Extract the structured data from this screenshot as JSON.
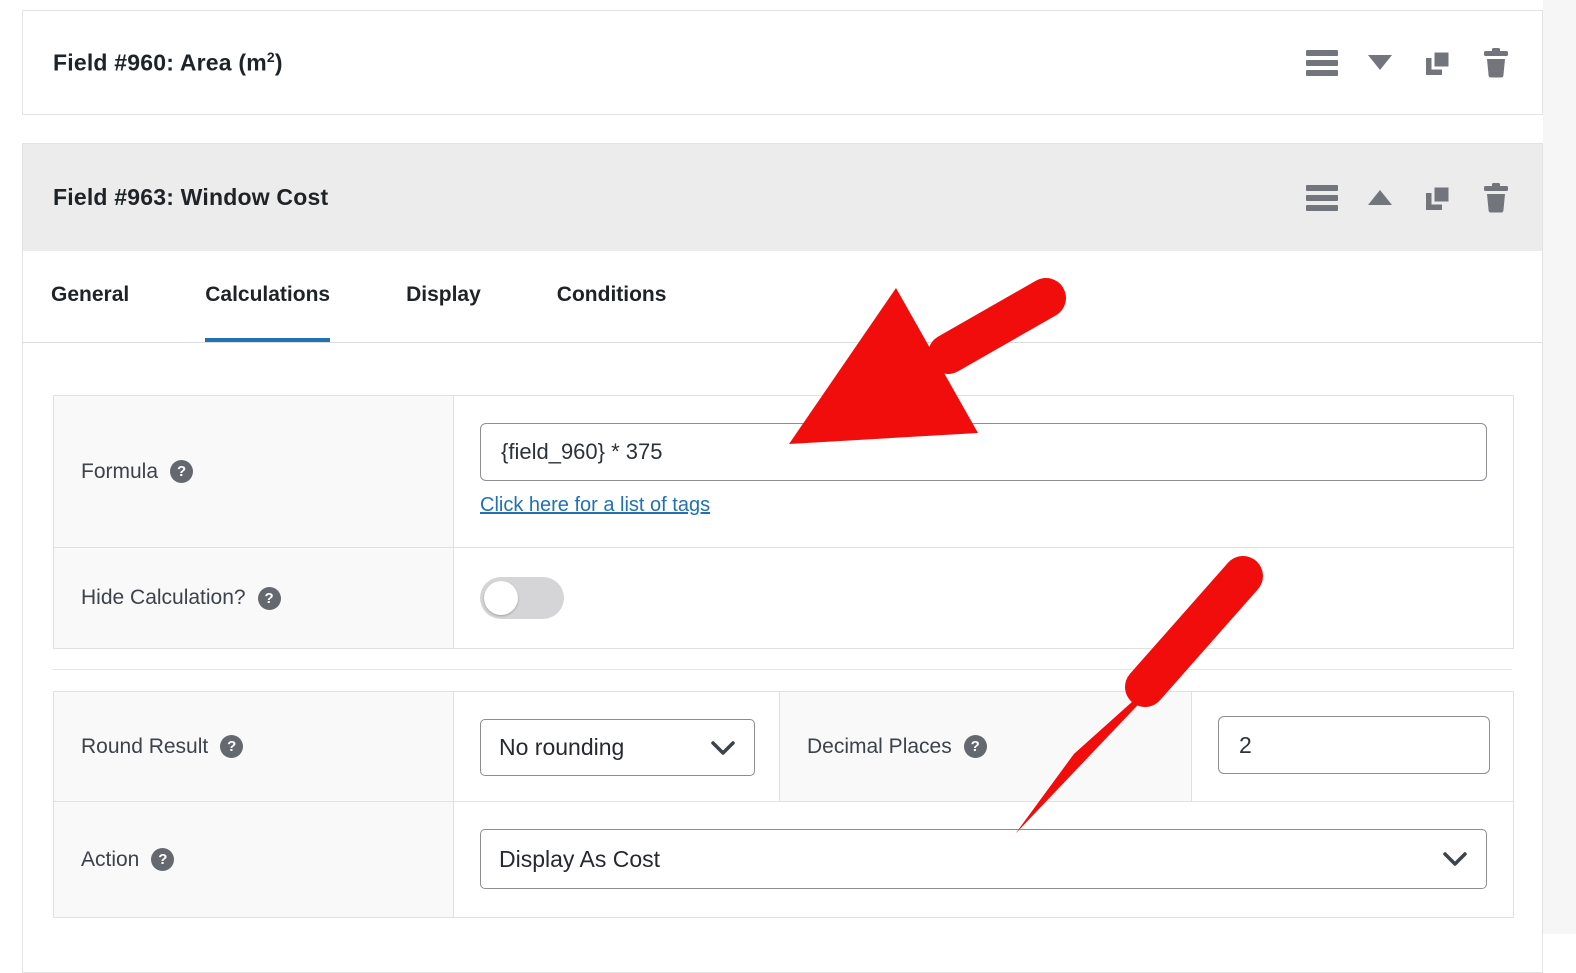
{
  "colors": {
    "accent_blue": "#2271b1",
    "annotation_red": "#f20d0d",
    "header_gray": "#ececec",
    "label_cell_bg": "#f9f9f9",
    "icon_gray": "#72767c"
  },
  "icons": {
    "help_glyph": "?"
  },
  "field_960": {
    "title_prefix": "Field #960: Area (m",
    "title_sup": "2",
    "title_suffix": ")"
  },
  "field_963": {
    "title": "Field #963: Window Cost",
    "tabs": [
      {
        "label": "General",
        "active": false
      },
      {
        "label": "Calculations",
        "active": true
      },
      {
        "label": "Display",
        "active": false
      },
      {
        "label": "Conditions",
        "active": false
      }
    ],
    "settings": {
      "formula": {
        "label": "Formula",
        "value": "{field_960} * 375",
        "tags_link": "Click here for a list of tags"
      },
      "hide_calculation": {
        "label": "Hide Calculation?",
        "enabled": false
      },
      "round_result": {
        "label": "Round Result",
        "value": "No rounding"
      },
      "decimal_places": {
        "label": "Decimal Places",
        "value": "2"
      },
      "action": {
        "label": "Action",
        "value": "Display As Cost"
      }
    }
  }
}
